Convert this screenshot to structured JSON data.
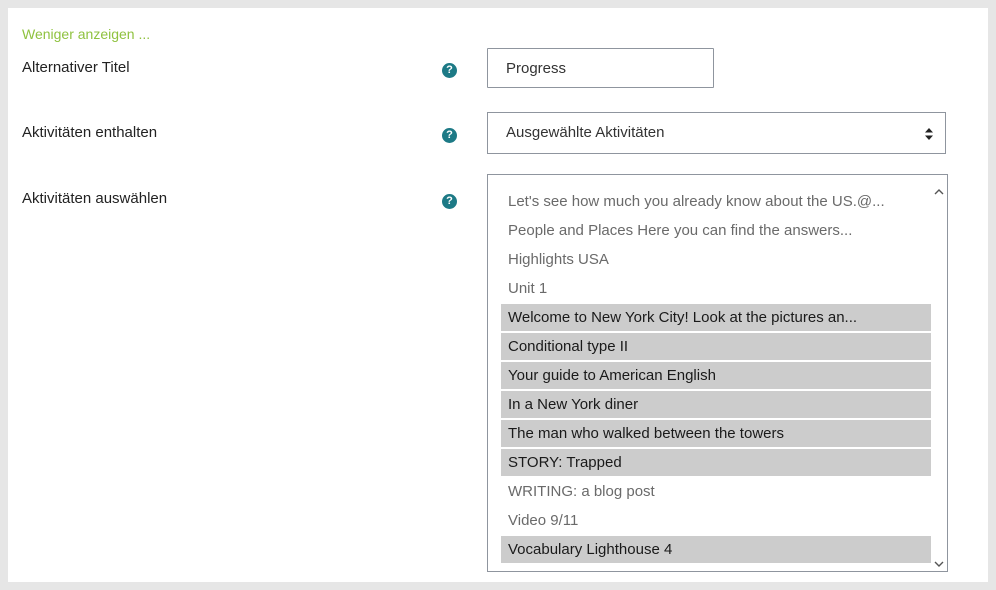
{
  "form": {
    "toggle_link": "Weniger anzeigen ...",
    "alt_title": {
      "label": "Alternativer Titel",
      "value": "Progress"
    },
    "include_activities": {
      "label": "Aktivitäten enthalten",
      "selected": "Ausgewählte Aktivitäten"
    },
    "select_activities": {
      "label": "Aktivitäten auswählen",
      "items": [
        {
          "label": "Let's see how much you already know about the US.@...",
          "selected": false
        },
        {
          "label": "People and Places Here you can find the answers...",
          "selected": false
        },
        {
          "label": "Highlights USA",
          "selected": false
        },
        {
          "label": "Unit 1",
          "selected": false
        },
        {
          "label": "Welcome to New York City! Look at the pictures an...",
          "selected": true
        },
        {
          "label": "Conditional type II",
          "selected": true
        },
        {
          "label": "Your guide to American English",
          "selected": true
        },
        {
          "label": "In a New York diner",
          "selected": true
        },
        {
          "label": "The man who walked between the towers",
          "selected": true
        },
        {
          "label": "STORY: Trapped",
          "selected": true
        },
        {
          "label": "WRITING: a blog post",
          "selected": false
        },
        {
          "label": "Video 9/11",
          "selected": false
        },
        {
          "label": "Vocabulary Lighthouse 4",
          "selected": true
        }
      ]
    },
    "help_glyph": "?"
  },
  "colors": {
    "link_green": "#8fc23f",
    "help_teal": "#1d7a86",
    "selected_bg": "#cccccc",
    "page_bg": "#e6e6e6"
  },
  "icons": {
    "help": "question-circle-icon",
    "select_arrows": "sort-arrows-icon",
    "scroll_up": "chevron-up-icon",
    "scroll_down": "chevron-down-icon"
  }
}
